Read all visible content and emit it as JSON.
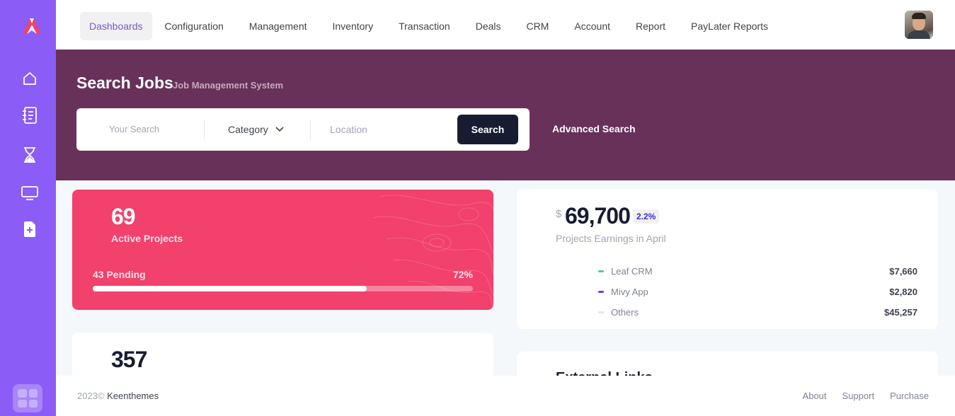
{
  "nav": {
    "items": [
      {
        "label": "Dashboards",
        "active": true
      },
      {
        "label": "Configuration"
      },
      {
        "label": "Management"
      },
      {
        "label": "Inventory"
      },
      {
        "label": "Transaction"
      },
      {
        "label": "Deals"
      },
      {
        "label": "CRM"
      },
      {
        "label": "Account"
      },
      {
        "label": "Report"
      },
      {
        "label": "PayLater Reports"
      }
    ]
  },
  "sidebar": {
    "icons": [
      "home-icon",
      "notebook-icon",
      "hourglass-icon",
      "monitor-icon",
      "file-add-icon"
    ],
    "accent": "#8b5cf6"
  },
  "banner": {
    "title": "Search Jobs",
    "subtitle": "Job Management System",
    "search_placeholder": "Your Search",
    "category_label": "Category",
    "location_placeholder": "Location",
    "search_button": "Search",
    "advanced_search": "Advanced Search",
    "background": "#67315a"
  },
  "projects_card": {
    "count": "69",
    "label": "Active Projects",
    "pending": "43 Pending",
    "percent_text": "72%",
    "progress": 0.72,
    "background": "#f1416c"
  },
  "second_card": {
    "count": "357"
  },
  "earnings_card": {
    "currency": "$",
    "amount": "69,700",
    "badge": "2.2%",
    "label": "Projects Earnings in April",
    "rows": [
      {
        "name": "Leaf CRM",
        "value": "$7,660",
        "color": "#50cd89"
      },
      {
        "name": "Mivy App",
        "value": "$2,820",
        "color": "#7239ea"
      },
      {
        "name": "Others",
        "value": "$45,257",
        "color": "#e4e6ef"
      }
    ]
  },
  "partial_card": {
    "title": "External Links"
  },
  "footer": {
    "year": "2023©",
    "brand": "Keenthemes",
    "links": [
      "About",
      "Support",
      "Purchase"
    ]
  }
}
